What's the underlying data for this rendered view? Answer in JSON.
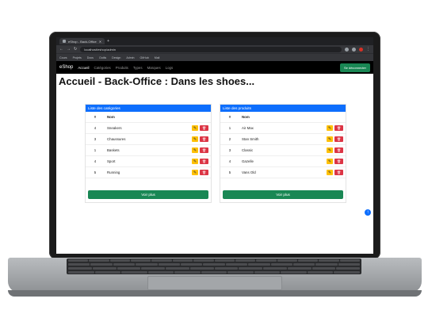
{
  "browser": {
    "tab_title": "eShop - Back-Office",
    "url": "localhost/eshop/admin",
    "bookmarks": [
      "Cours",
      "Projets",
      "Docs",
      "Outils",
      "Design",
      "Admin",
      "GitHub",
      "Mail"
    ]
  },
  "navbar": {
    "brand": "eShop",
    "links": [
      "Accueil",
      "Catégories",
      "Produits",
      "Types",
      "Marques",
      "Logs"
    ],
    "action_label": "Se déconnecter"
  },
  "page": {
    "title": "Accueil - Back-Office : Dans les shoes..."
  },
  "card_left": {
    "header": "Liste des catégories",
    "col_id": "#",
    "col_name": "Nom",
    "rows": [
      {
        "id": "4",
        "name": "Sneakers"
      },
      {
        "id": "3",
        "name": "Chaussures"
      },
      {
        "id": "1",
        "name": "Baskets"
      },
      {
        "id": "4",
        "name": "Sport"
      },
      {
        "id": "5",
        "name": "Running"
      }
    ],
    "more_label": "Voir plus"
  },
  "card_right": {
    "header": "Liste des produits",
    "col_id": "#",
    "col_name": "Nom",
    "rows": [
      {
        "id": "1",
        "name": "Air Max"
      },
      {
        "id": "2",
        "name": "Stan Smith"
      },
      {
        "id": "3",
        "name": "Classic"
      },
      {
        "id": "4",
        "name": "Gazelle"
      },
      {
        "id": "5",
        "name": "Vans Old"
      }
    ],
    "more_label": "Voir plus"
  },
  "icons": {
    "edit": "pencil-icon",
    "delete": "trash-icon"
  },
  "colors": {
    "primary": "#0d6efd",
    "success": "#198754",
    "warning": "#ffc107",
    "danger": "#dc3545"
  }
}
